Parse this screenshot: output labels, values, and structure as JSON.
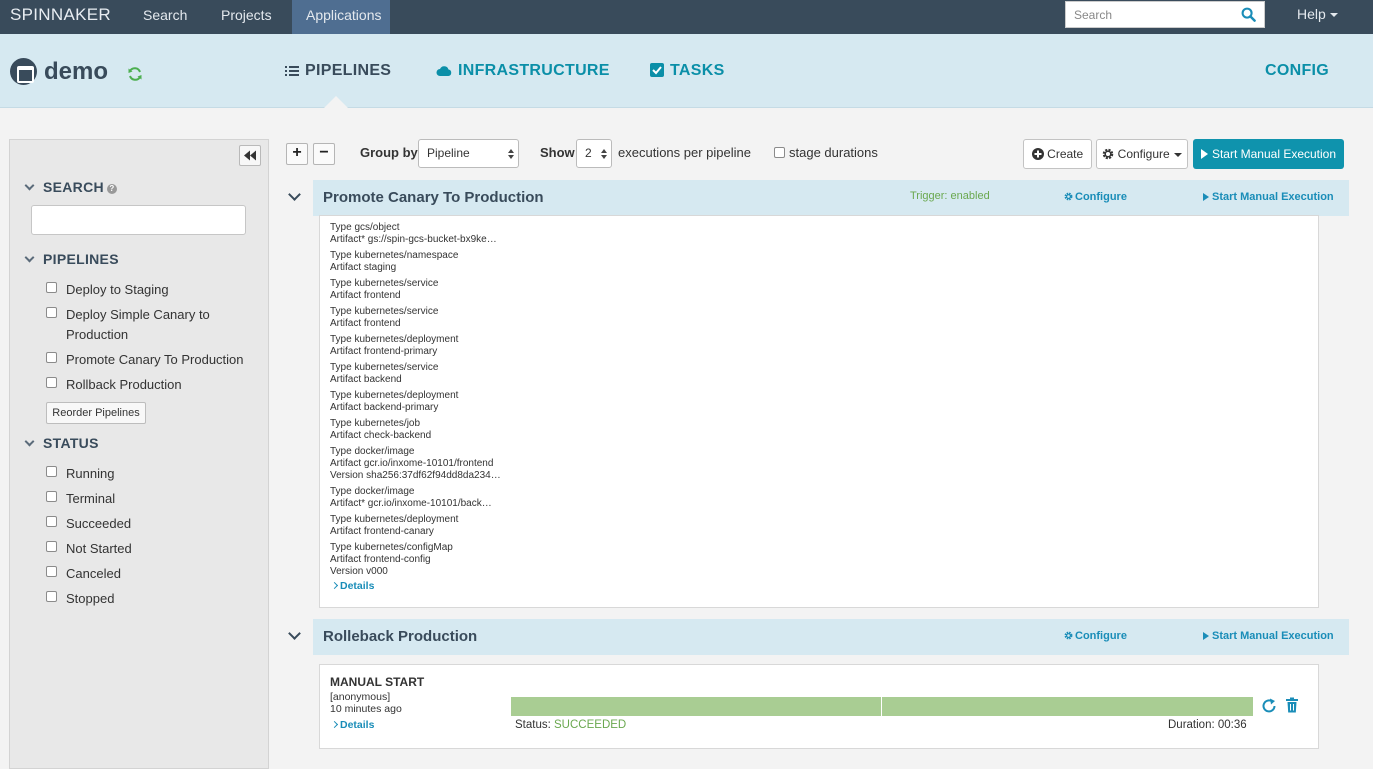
{
  "topnav": {
    "brand": "SPINNAKER",
    "links": [
      "Search",
      "Projects",
      "Applications"
    ],
    "search_placeholder": "Search",
    "help": "Help"
  },
  "app": {
    "name": "demo",
    "tabs": {
      "pipelines": "PIPELINES",
      "infrastructure": "INFRASTRUCTURE",
      "tasks": "TASKS",
      "config": "CONFIG"
    }
  },
  "sidebar": {
    "search_heading": "SEARCH",
    "search_value": "",
    "pipelines_heading": "PIPELINES",
    "pipelines": [
      "Deploy to Staging",
      "Deploy Simple Canary to Production",
      "Promote Canary To Production",
      "Rollback Production"
    ],
    "reorder_label": "Reorder Pipelines",
    "status_heading": "STATUS",
    "statuses": [
      "Running",
      "Terminal",
      "Succeeded",
      "Not Started",
      "Canceled",
      "Stopped"
    ]
  },
  "toolbar": {
    "group_by_label": "Group by",
    "group_by_value": "Pipeline",
    "show_label": "Show",
    "show_value": "2",
    "executions_text": "executions per pipeline",
    "stage_durations": "stage durations",
    "create": "Create",
    "configure": "Configure",
    "start_manual": "Start Manual Execution"
  },
  "pipelines": [
    {
      "title": "Promote Canary To Production",
      "trigger": "Trigger: enabled",
      "configure": "Configure",
      "start": "Start Manual Execution",
      "artifacts": [
        [
          "Type  gcs/object",
          "Artifact*  gs://spin-gcs-bucket-bx9ke…"
        ],
        [
          "Type  kubernetes/namespace",
          "Artifact  staging"
        ],
        [
          "Type  kubernetes/service",
          "Artifact  frontend"
        ],
        [
          "Type  kubernetes/service",
          "Artifact  frontend"
        ],
        [
          "Type  kubernetes/deployment",
          "Artifact  frontend-primary"
        ],
        [
          "Type  kubernetes/service",
          "Artifact  backend"
        ],
        [
          "Type  kubernetes/deployment",
          "Artifact  backend-primary"
        ],
        [
          "Type  kubernetes/job",
          "Artifact  check-backend"
        ],
        [
          "Type  docker/image",
          "Artifact  gcr.io/inxome-10101/frontend",
          "Version  sha256:37df62f94dd8da234…"
        ],
        [
          "Type  docker/image",
          "Artifact*  gcr.io/inxome-10101/back…"
        ],
        [
          "Type  kubernetes/deployment",
          "Artifact  frontend-canary"
        ],
        [
          "Type  kubernetes/configMap",
          "Artifact  frontend-config",
          "Version  v000"
        ]
      ],
      "details": "Details"
    },
    {
      "title": "Rolleback Production",
      "configure": "Configure",
      "start": "Start Manual Execution",
      "execution": {
        "trigger": "MANUAL START",
        "user": "[anonymous]",
        "time": "10 minutes ago",
        "details": "Details",
        "status_label": "Status:",
        "status": "SUCCEEDED",
        "duration": "Duration: 00:36",
        "progress": 1.0
      }
    }
  ]
}
